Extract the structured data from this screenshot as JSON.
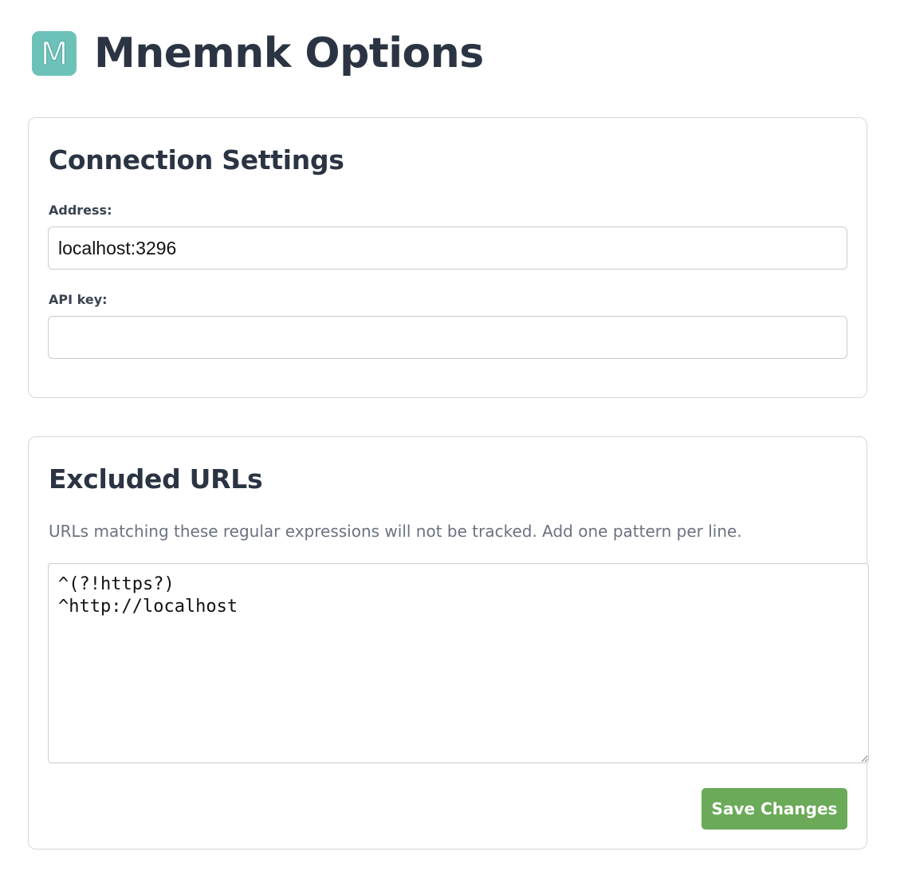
{
  "header": {
    "title": "Mnemnk Options",
    "logo_letter": "M",
    "logo_color": "#6cc2b9"
  },
  "connection": {
    "title": "Connection Settings",
    "address_label": "Address:",
    "address_value": "localhost:3296",
    "api_key_label": "API key:",
    "api_key_value": ""
  },
  "excluded": {
    "title": "Excluded URLs",
    "description": "URLs matching these regular expressions will not be tracked. Add one pattern per line.",
    "patterns": "^(?!https?)\n^http://localhost"
  },
  "actions": {
    "save_label": "Save Changes",
    "save_color": "#6aaa58"
  }
}
